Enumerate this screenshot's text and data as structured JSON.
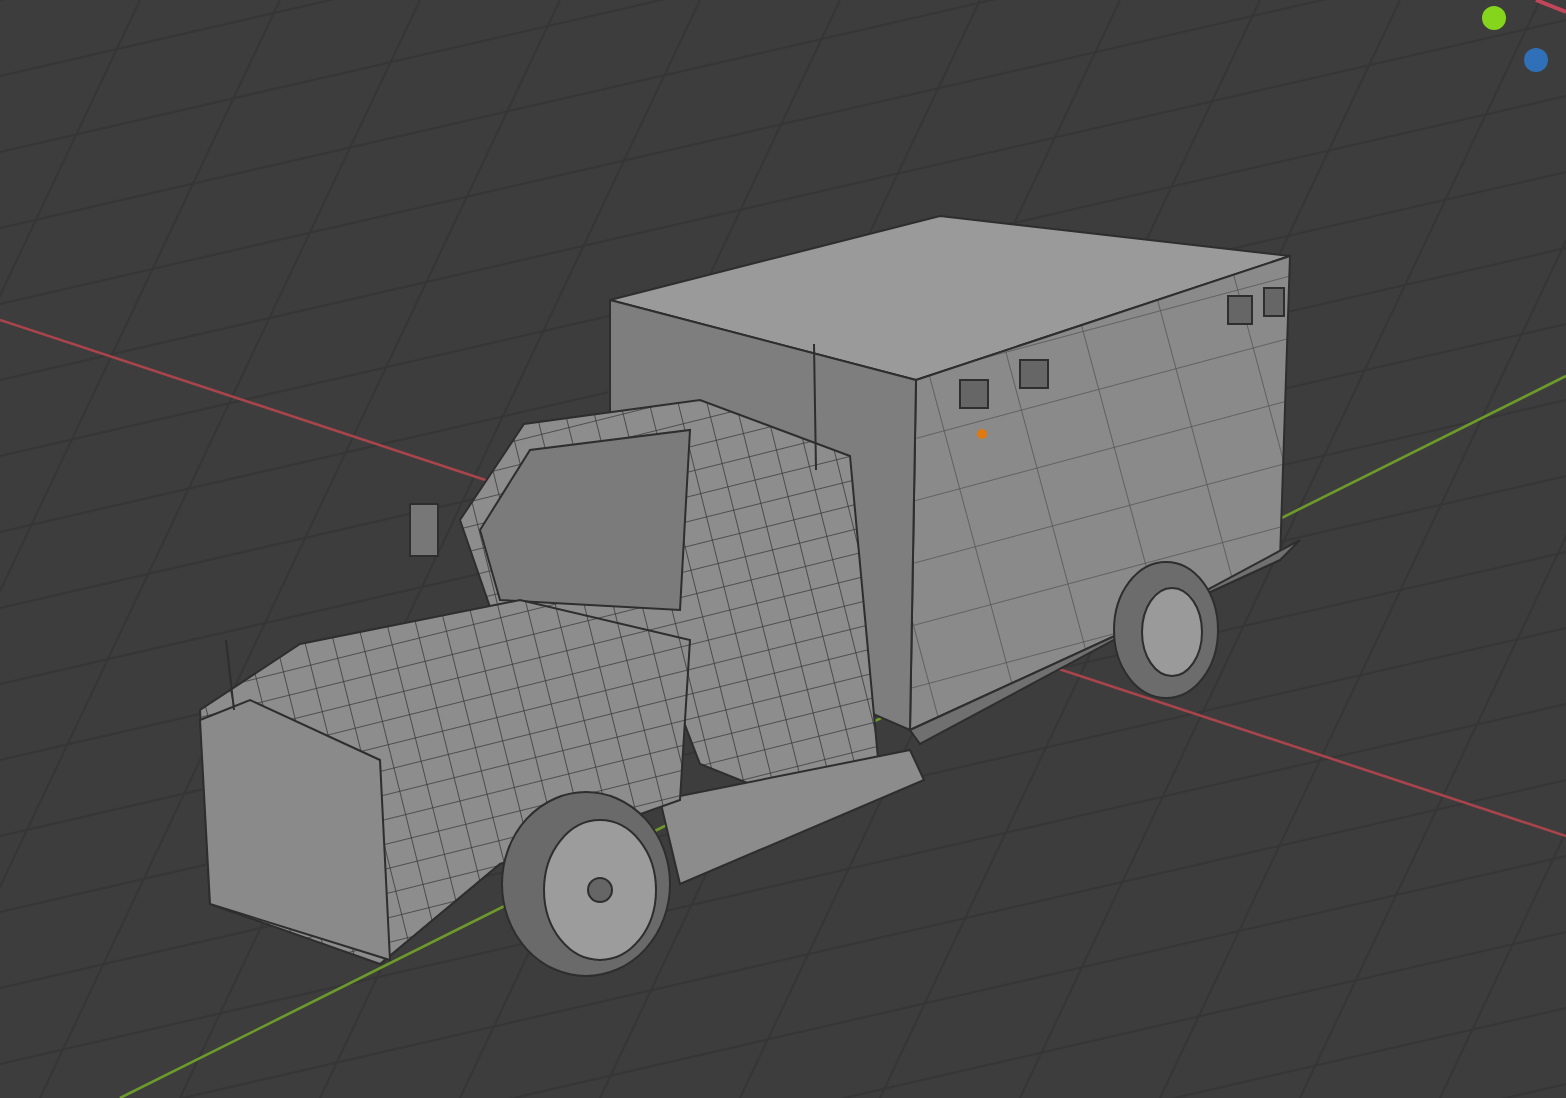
{
  "viewport": {
    "axis_lines": [
      {
        "color": "#a8444b"
      },
      {
        "color": "#6e9a2c"
      }
    ],
    "gizmo": [
      {
        "color": "#84d51b"
      },
      {
        "color": "#3070b8"
      }
    ]
  }
}
